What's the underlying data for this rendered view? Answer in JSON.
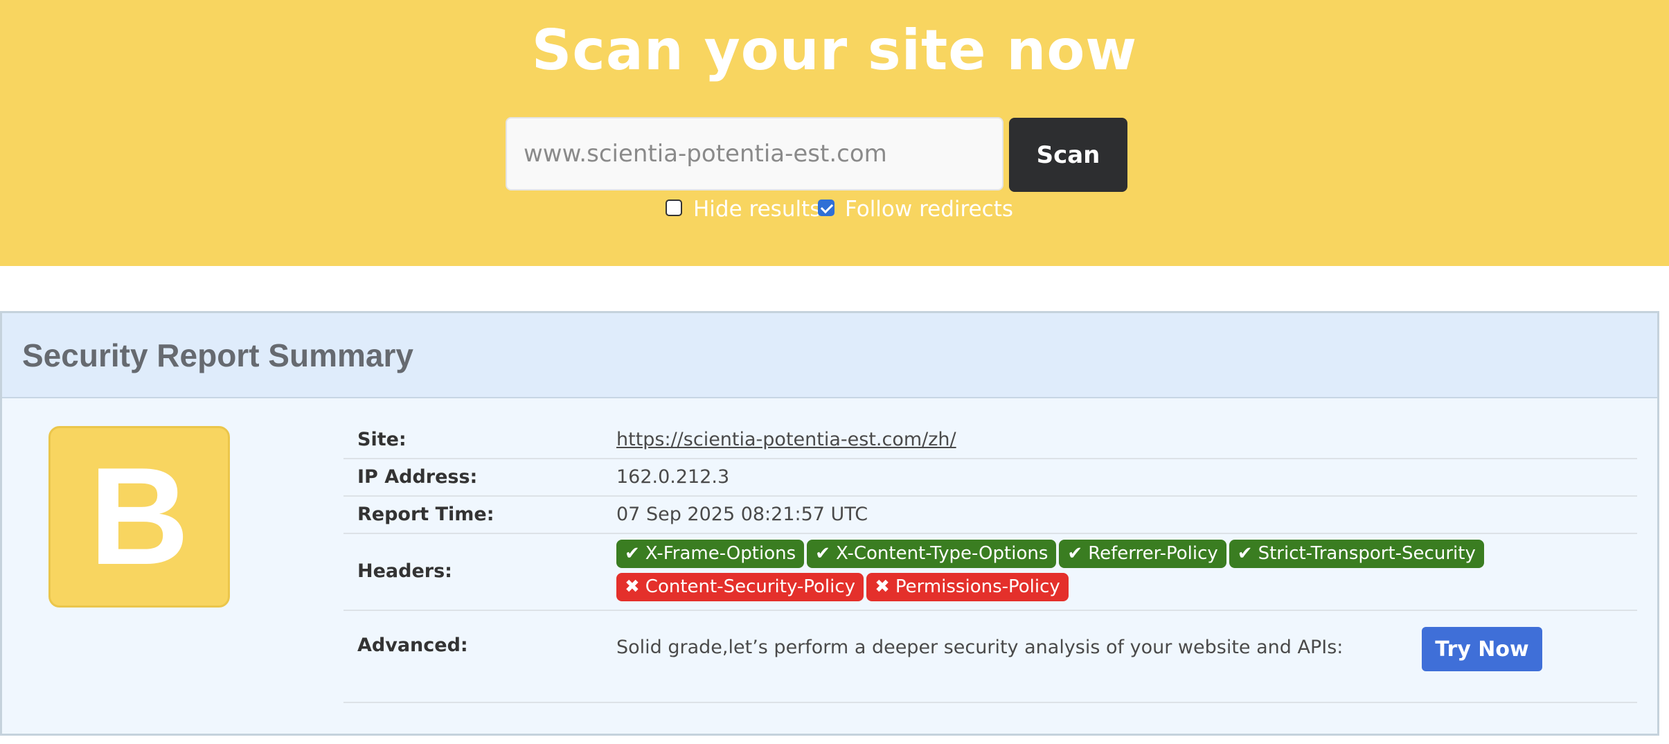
{
  "hero": {
    "title": "Scan your site now",
    "search_placeholder": "www.scientia-potentia-est.com",
    "search_value": "",
    "scan_label": "Scan",
    "options": {
      "hide_results": {
        "label": "Hide results",
        "checked": false
      },
      "follow_redirects": {
        "label": "Follow redirects",
        "checked": true
      }
    }
  },
  "report": {
    "title": "Security Report Summary",
    "grade": "B",
    "grade_color": "#f8d560",
    "rows": {
      "site": {
        "label": "Site:",
        "value": "https://scientia-potentia-est.com/zh/"
      },
      "ip": {
        "label": "IP Address:",
        "value": "162.0.212.3"
      },
      "time": {
        "label": "Report Time:",
        "value": "07 Sep 2025 08:21:57 UTC"
      },
      "headers": {
        "label": "Headers:",
        "passed": [
          "X-Frame-Options",
          "X-Content-Type-Options",
          "Referrer-Policy",
          "Strict-Transport-Security"
        ],
        "failed": [
          "Content-Security-Policy",
          "Permissions-Policy"
        ]
      },
      "advanced": {
        "label": "Advanced:",
        "text": "Solid grade,let’s perform a deeper security analysis of your website and APIs:",
        "button_label": "Try Now"
      }
    },
    "colors": {
      "pass": "#3a7d21",
      "fail": "#e4302b",
      "link": "#2a64c5",
      "accent_button": "#3f6fd8"
    },
    "icons": {
      "pass": "check-icon",
      "fail": "x-icon"
    }
  }
}
